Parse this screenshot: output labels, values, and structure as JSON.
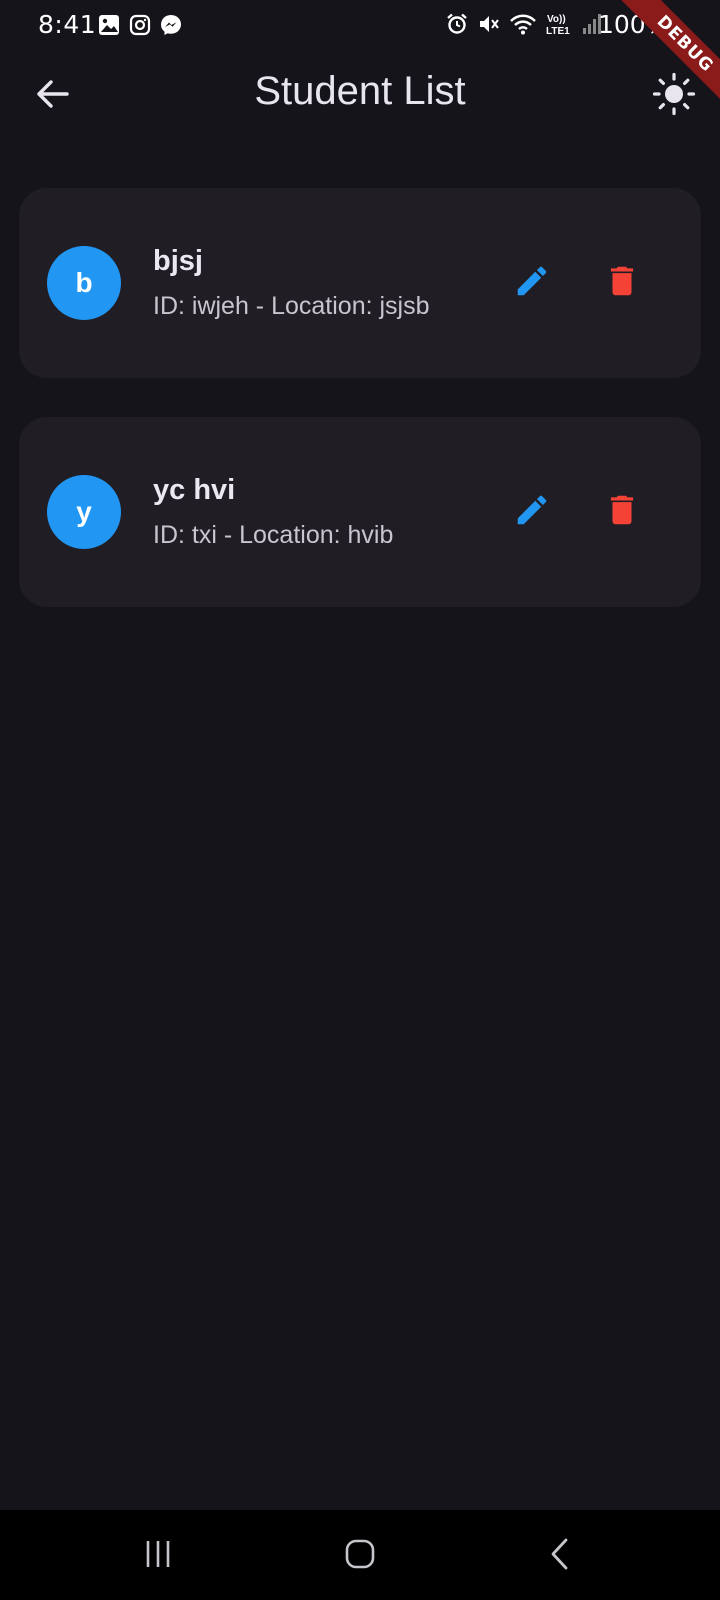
{
  "status_bar": {
    "time": "8:41",
    "battery": "100%",
    "left_icons": [
      "gallery-icon",
      "instagram-icon",
      "messenger-icon"
    ],
    "right_icons": [
      "alarm-icon",
      "mute-icon",
      "wifi-icon",
      "volte-icon",
      "signal-icon"
    ]
  },
  "debug_banner": "DEBUG",
  "app_bar": {
    "title": "Student List",
    "back_icon": "arrow-left-icon",
    "theme_icon": "sun-icon"
  },
  "students": [
    {
      "initial": "b",
      "name": "bjsj",
      "subtitle": "ID: iwjeh - Location: jsjsb"
    },
    {
      "initial": "y",
      "name": "yc hvi",
      "subtitle": "ID: txi - Location: hvib"
    }
  ],
  "colors": {
    "background": "#16141b",
    "card": "#201e24",
    "avatar": "#2196f3",
    "edit": "#2196f3",
    "delete": "#f44336",
    "debug": "#8b1a1a"
  }
}
